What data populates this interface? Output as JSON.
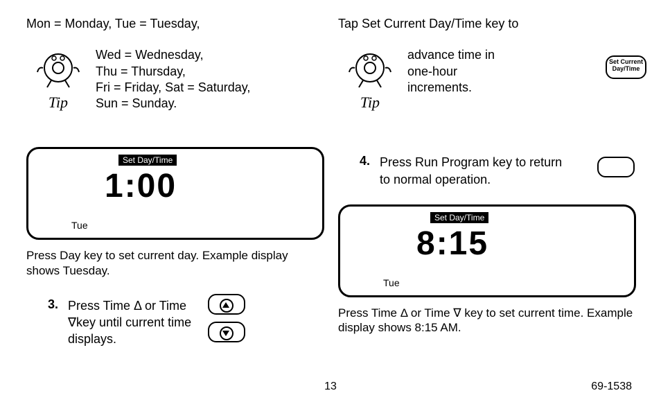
{
  "left": {
    "intro_line1": "Mon = Monday, Tue = Tuesday,",
    "tip_lines": "Wed = Wednesday,\nThu = Thursday,\nFri = Friday, Sat = Saturday,\nSun = Sunday.",
    "tip_label": "Tip",
    "lcd": {
      "badge": "Set Day/Time",
      "time": "1:00",
      "day": "Tue"
    },
    "caption1": "Press Day key to set current day. Example display shows Tuesday.",
    "step3_num": "3.",
    "step3_text": "Press Time Δ or Time ∇key until current time displays."
  },
  "right": {
    "intro_line1": "Tap Set Current Day/Time key to",
    "tip_lines": "advance time in one-hour increments.",
    "tip_label": "Tip",
    "key_setcurrent": "Set Current\nDay/Time",
    "step4_num": "4.",
    "step4_text": "Press Run Program key to return to normal operation.",
    "lcd": {
      "badge": "Set Day/Time",
      "time": "8:15",
      "day": "Tue"
    },
    "caption2": "Press Time Δ or Time ∇ key to set current time. Example display shows 8:15 AM."
  },
  "footer": {
    "page": "13",
    "docnum": "69-1538"
  }
}
